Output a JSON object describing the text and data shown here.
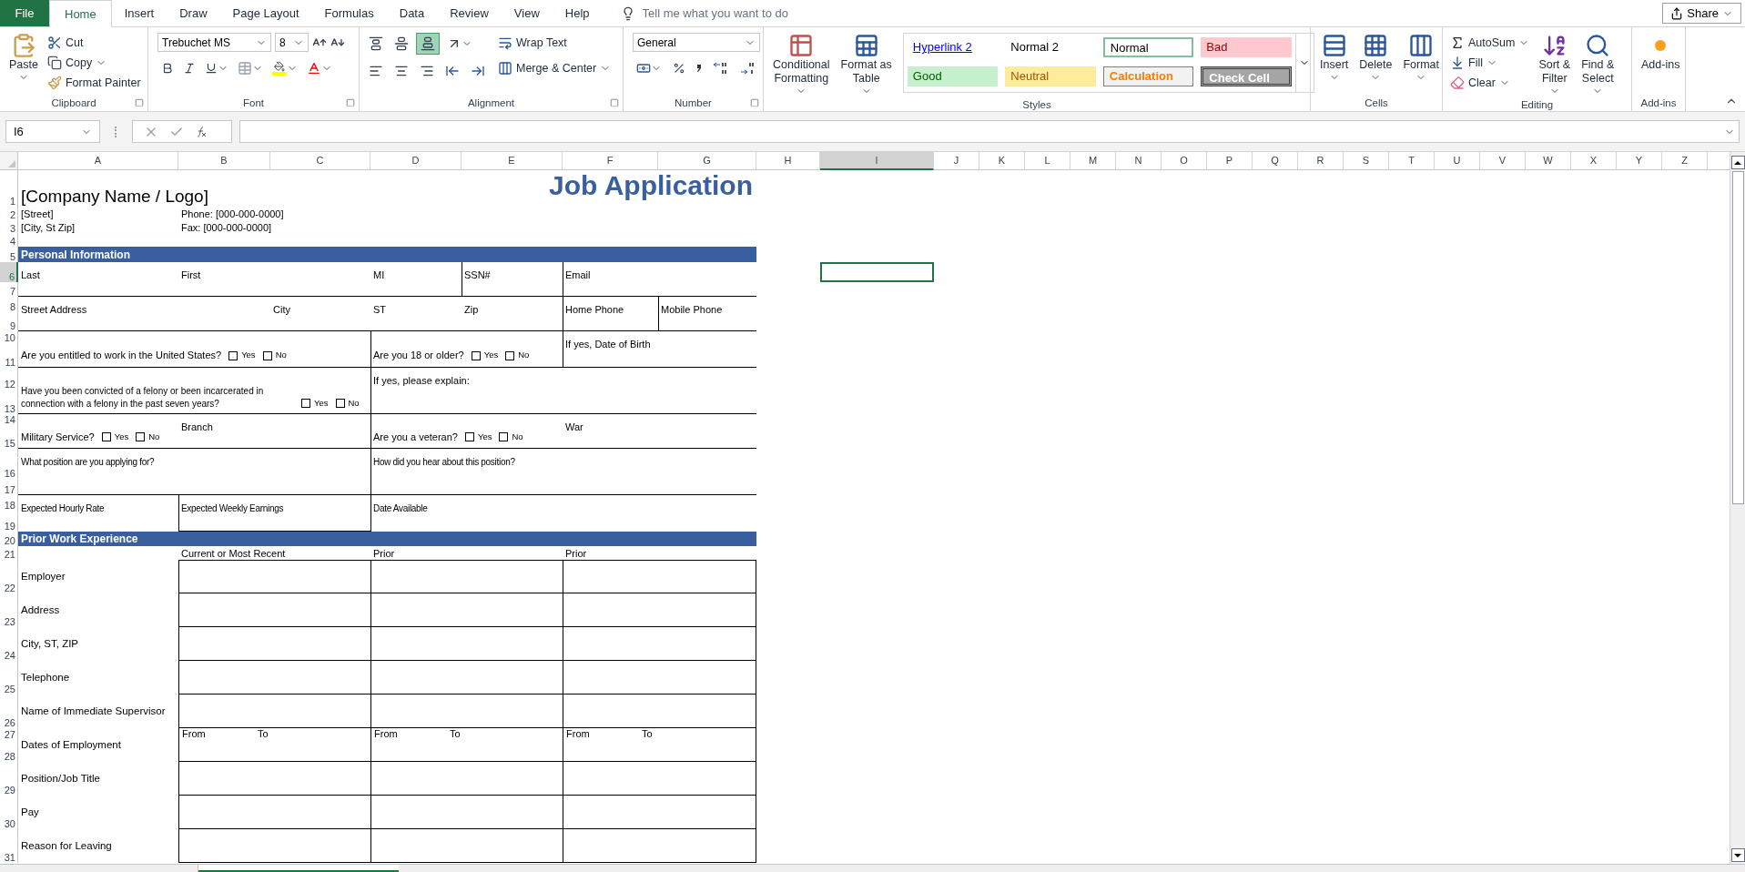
{
  "ribbon_tabs": [
    {
      "label": "File",
      "kind": "file",
      "selected": false
    },
    {
      "label": "Home",
      "kind": "tab",
      "selected": true
    },
    {
      "label": "Insert",
      "kind": "tab",
      "selected": false
    },
    {
      "label": "Draw",
      "kind": "tab",
      "selected": false
    },
    {
      "label": "Page Layout",
      "kind": "tab",
      "selected": false
    },
    {
      "label": "Formulas",
      "kind": "tab",
      "selected": false
    },
    {
      "label": "Data",
      "kind": "tab",
      "selected": false
    },
    {
      "label": "Review",
      "kind": "tab",
      "selected": false
    },
    {
      "label": "View",
      "kind": "tab",
      "selected": false
    },
    {
      "label": "Help",
      "kind": "tab",
      "selected": false
    }
  ],
  "tell_me": {
    "placeholder": "Tell me what you want to do"
  },
  "share_button": "Share",
  "clipboard": {
    "group": "Clipboard",
    "paste": "Paste",
    "cut": "Cut",
    "copy": "Copy",
    "format_painter": "Format Painter"
  },
  "font": {
    "group": "Font",
    "font_name": "Trebuchet MS",
    "font_size": "8"
  },
  "alignment": {
    "group": "Alignment",
    "wrap_text": "Wrap Text",
    "merge": "Merge & Center"
  },
  "number": {
    "group": "Number",
    "format": "General"
  },
  "styles": {
    "group": "Styles",
    "conditional": [
      "Conditional",
      "Formatting"
    ],
    "format_table": [
      "Format as",
      "Table"
    ],
    "gallery": [
      {
        "label": "Hyperlink 2",
        "kind": "hyperlink",
        "selected": false
      },
      {
        "label": "Normal 2",
        "kind": "plain",
        "selected": false
      },
      {
        "label": "Normal",
        "kind": "plain",
        "selected": true
      },
      {
        "label": "Bad",
        "kind": "bad",
        "selected": false
      },
      {
        "label": "Good",
        "kind": "good",
        "selected": false
      },
      {
        "label": "Neutral",
        "kind": "neutral",
        "selected": false
      },
      {
        "label": "Calculation",
        "kind": "calculation",
        "selected": false
      },
      {
        "label": "Check Cell",
        "kind": "check",
        "selected": false
      }
    ]
  },
  "cells": {
    "group": "Cells",
    "buttons": [
      "Insert",
      "Delete",
      "Format"
    ]
  },
  "editing": {
    "group": "Editing",
    "autosum": "AutoSum",
    "fill": "Fill",
    "clear": "Clear",
    "sort": [
      "Sort &",
      "Filter"
    ],
    "find": [
      "Find &",
      "Select"
    ]
  },
  "addins": {
    "group": "Add-ins",
    "button": "Add-ins"
  },
  "name_box": "I6",
  "columns": [
    {
      "label": "A",
      "selected": false
    },
    {
      "label": "B",
      "selected": false
    },
    {
      "label": "C",
      "selected": false
    },
    {
      "label": "D",
      "selected": false
    },
    {
      "label": "E",
      "selected": false
    },
    {
      "label": "F",
      "selected": false
    },
    {
      "label": "G",
      "selected": false
    },
    {
      "label": "H",
      "selected": false
    },
    {
      "label": "I",
      "selected": true
    },
    {
      "label": "J",
      "selected": false
    },
    {
      "label": "K",
      "selected": false
    },
    {
      "label": "L",
      "selected": false
    },
    {
      "label": "M",
      "selected": false
    },
    {
      "label": "N",
      "selected": false
    },
    {
      "label": "O",
      "selected": false
    },
    {
      "label": "P",
      "selected": false
    },
    {
      "label": "Q",
      "selected": false
    },
    {
      "label": "R",
      "selected": false
    },
    {
      "label": "S",
      "selected": false
    },
    {
      "label": "T",
      "selected": false
    },
    {
      "label": "U",
      "selected": false
    },
    {
      "label": "V",
      "selected": false
    },
    {
      "label": "W",
      "selected": false
    },
    {
      "label": "X",
      "selected": false
    },
    {
      "label": "Y",
      "selected": false
    },
    {
      "label": "Z",
      "selected": false
    }
  ],
  "rows": [
    {
      "label": "1",
      "selected": false
    },
    {
      "label": "2",
      "selected": false
    },
    {
      "label": "3",
      "selected": false
    },
    {
      "label": "4",
      "selected": false
    },
    {
      "label": "5",
      "selected": false
    },
    {
      "label": "6",
      "selected": true
    },
    {
      "label": "7",
      "selected": false
    },
    {
      "label": "8",
      "selected": false
    },
    {
      "label": "9",
      "selected": false
    },
    {
      "label": "10",
      "selected": false
    },
    {
      "label": "11",
      "selected": false
    },
    {
      "label": "12",
      "selected": false
    },
    {
      "label": "13",
      "selected": false
    },
    {
      "label": "14",
      "selected": false
    },
    {
      "label": "15",
      "selected": false
    },
    {
      "label": "16",
      "selected": false
    },
    {
      "label": "17",
      "selected": false
    },
    {
      "label": "18",
      "selected": false
    },
    {
      "label": "19",
      "selected": false
    },
    {
      "label": "20",
      "selected": false
    },
    {
      "label": "21",
      "selected": false
    },
    {
      "label": "22",
      "selected": false
    },
    {
      "label": "23",
      "selected": false
    },
    {
      "label": "24",
      "selected": false
    },
    {
      "label": "25",
      "selected": false
    },
    {
      "label": "26",
      "selected": false
    },
    {
      "label": "27",
      "selected": false
    },
    {
      "label": "28",
      "selected": false
    },
    {
      "label": "29",
      "selected": false
    },
    {
      "label": "30",
      "selected": false
    },
    {
      "label": "31",
      "selected": false
    }
  ],
  "header": {
    "company": "[Company Name / Logo]",
    "title": "Job Application",
    "street": "[Street]",
    "city": "[City, St Zip]",
    "phone": "Phone: [000-000-0000]",
    "fax": "Fax: [000-000-0000]"
  },
  "personal": {
    "heading": "Personal Information",
    "fields": [
      "Last",
      "First",
      "MI",
      "SSN#",
      "Email",
      "Street Address",
      "City",
      "ST",
      "Zip",
      "Home Phone",
      "Mobile Phone",
      "If yes, Date of Birth",
      "If yes, please explain:",
      "Branch",
      "War",
      "What position are you applying for?",
      "How did you hear about this position?",
      "Expected Hourly Rate",
      "Expected Weekly Earnings",
      "Date Available"
    ],
    "questions": [
      {
        "text": "Are you entitled to work in the United States?",
        "options": [
          {
            "label": "Yes",
            "checked": false
          },
          {
            "label": "No",
            "checked": false
          }
        ]
      },
      {
        "text": "Are you 18 or older?",
        "options": [
          {
            "label": "Yes",
            "checked": false
          },
          {
            "label": "No",
            "checked": false
          }
        ]
      },
      {
        "text": "Have you been convicted of a felony or been incarcerated in connection with a felony in the past seven years?",
        "options": [
          {
            "label": "Yes",
            "checked": false
          },
          {
            "label": "No",
            "checked": false
          }
        ]
      },
      {
        "text": "Military Service?",
        "options": [
          {
            "label": "Yes",
            "checked": false
          },
          {
            "label": "No",
            "checked": false
          }
        ]
      },
      {
        "text": "Are you a veteran?",
        "options": [
          {
            "label": "Yes",
            "checked": false
          },
          {
            "label": "No",
            "checked": false
          }
        ]
      }
    ]
  },
  "work": {
    "heading": "Prior Work Experience",
    "columns": [
      "Current or Most Recent",
      "Prior",
      "Prior"
    ],
    "rows": [
      {
        "label": "Employer",
        "kind": "text"
      },
      {
        "label": "Address",
        "kind": "text"
      },
      {
        "label": "City, ST, ZIP",
        "kind": "text"
      },
      {
        "label": "Telephone",
        "kind": "text"
      },
      {
        "label": "Name of Immediate Supervisor",
        "kind": "text"
      },
      {
        "label": "Dates of Employment",
        "kind": "dates",
        "columns": [
          {
            "from": "From",
            "to": "To"
          },
          {
            "from": "From",
            "to": "To"
          },
          {
            "from": "From",
            "to": "To"
          }
        ]
      },
      {
        "label": "Position/Job Title",
        "kind": "text"
      },
      {
        "label": "Pay",
        "kind": "text"
      },
      {
        "label": "Reason for Leaving",
        "kind": "text"
      }
    ]
  }
}
